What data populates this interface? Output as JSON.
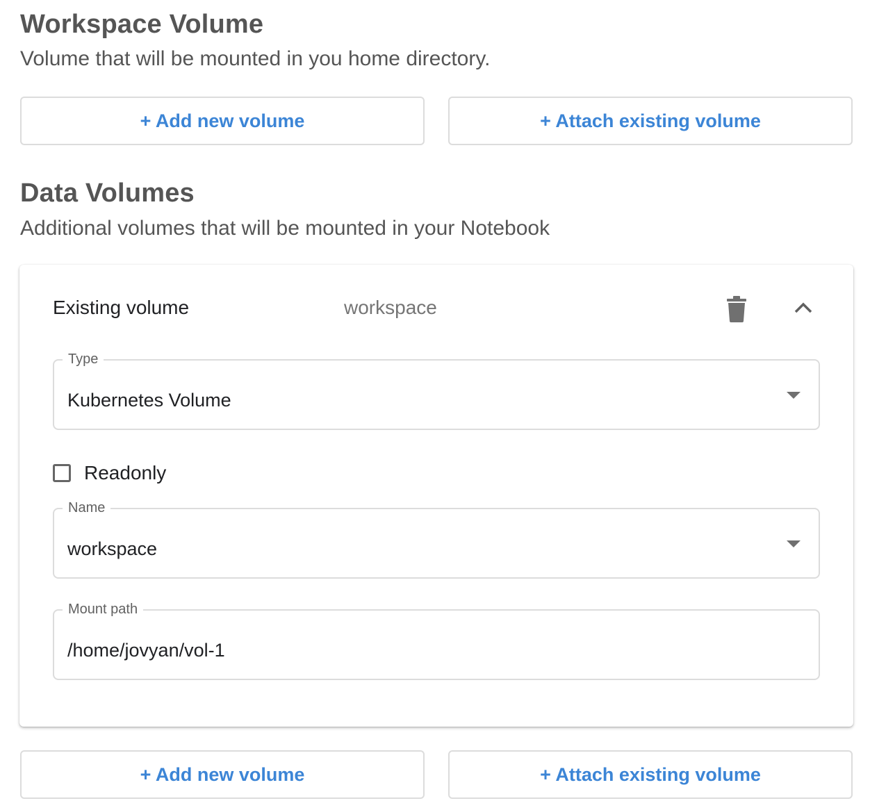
{
  "workspace": {
    "title": "Workspace Volume",
    "description": "Volume that will be mounted in you home directory.",
    "add_button": "+ Add new volume",
    "attach_button": "+ Attach existing volume"
  },
  "data_volumes": {
    "title": "Data Volumes",
    "description": "Additional volumes that will be mounted in your Notebook",
    "volume": {
      "header_title": "Existing volume",
      "header_name": "workspace",
      "delete_icon": "trash-icon",
      "collapse_icon": "chevron-up-icon",
      "type_label": "Type",
      "type_value": "Kubernetes Volume",
      "readonly_label": "Readonly",
      "readonly_checked": false,
      "name_label": "Name",
      "name_value": "workspace",
      "mount_label": "Mount path",
      "mount_value": "/home/jovyan/vol-1"
    },
    "add_button": "+ Add new volume",
    "attach_button": "+ Attach existing volume"
  },
  "colors": {
    "accent": "#3c85d6",
    "heading": "#555555",
    "border": "#dcdcdc",
    "icon": "#707070"
  }
}
